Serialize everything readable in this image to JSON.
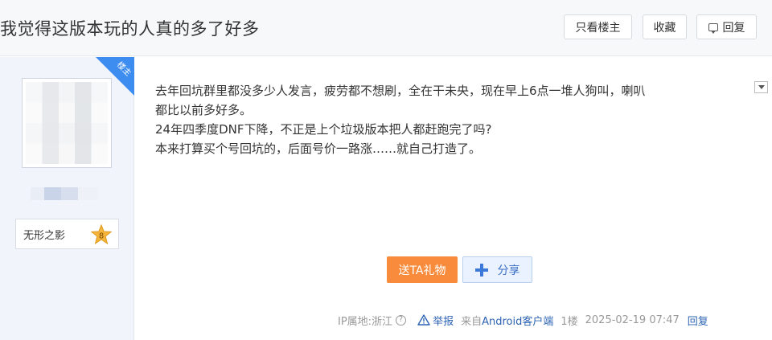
{
  "header": {
    "title": "我觉得这版本玩的人真的多了好多",
    "only_op_label": "只看楼主",
    "favorite_label": "收藏",
    "reply_label": "回复"
  },
  "author": {
    "level_name": "无形之影",
    "level_number": "8",
    "corner_tag": "楼主"
  },
  "post": {
    "paragraphs": [
      "去年回坑群里都没多少人发言，疲劳都不想刷，全在干未央，现在早上6点一堆人狗叫，喇叭\n都比以前多好多。",
      "24年四季度DNF下降，不正是上个垃圾版本把人都赶跑完了吗?",
      "本来打算买个号回坑的，后面号价一路涨……就自己打造了。"
    ]
  },
  "actions": {
    "gift_label": "送TA礼物",
    "share_label": "分享"
  },
  "footer": {
    "ip_location": "IP属地:浙江",
    "help_glyph": "?",
    "report_label": "举报",
    "from_prefix": "来自",
    "from_client": "Android客户端",
    "floor": "1楼",
    "timestamp": "2025-02-19 07:47",
    "reply_label": "回复"
  },
  "colors": {
    "accent_blue": "#2d64b3",
    "gift_orange": "#f98c3c",
    "corner_tag_blue": "#3d8cf0",
    "sidebar_bg": "#f1f4fb",
    "level_star": "#f5b53b"
  },
  "icons": {
    "reply": "reply-icon",
    "dropdown": "dropdown-arrow-icon",
    "share": "plus-cross-icon",
    "report": "warning-triangle-icon",
    "help": "question-circle-icon",
    "level": "star-badge-icon"
  }
}
